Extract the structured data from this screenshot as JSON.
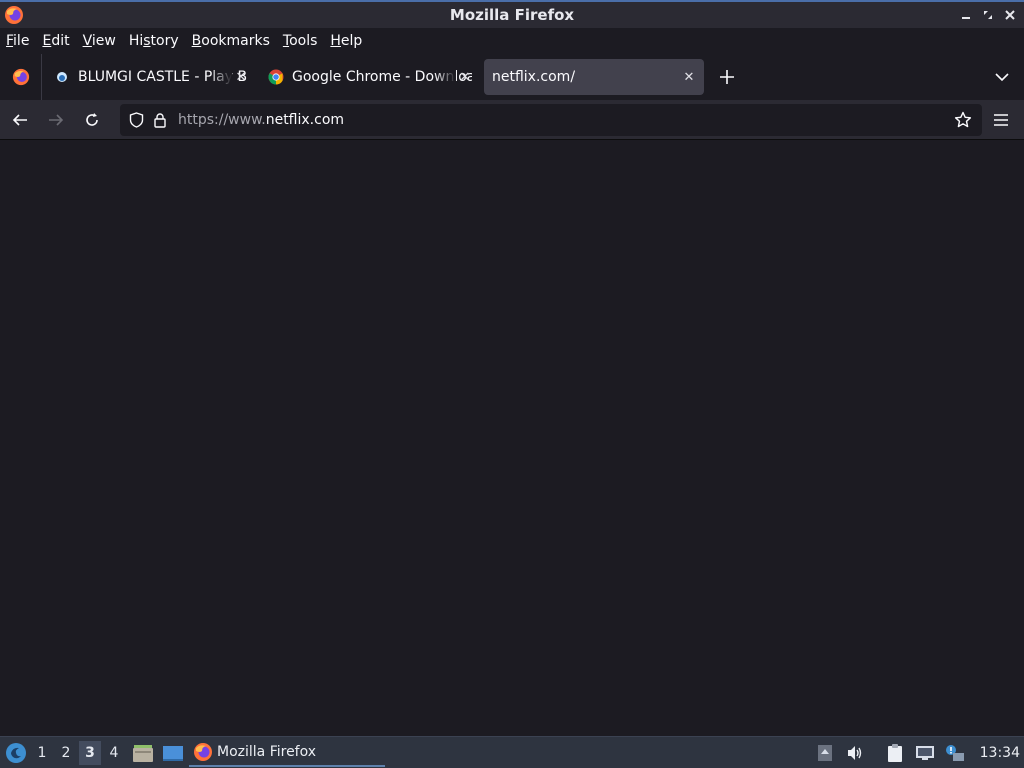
{
  "window": {
    "title": "Mozilla Firefox"
  },
  "menubar": {
    "items": [
      {
        "u": "F",
        "rest": "ile"
      },
      {
        "u": "E",
        "rest": "dit"
      },
      {
        "u": "V",
        "rest": "iew"
      },
      {
        "pre": "Hi",
        "u": "s",
        "rest": "tory"
      },
      {
        "u": "B",
        "rest": "ookmarks"
      },
      {
        "u": "T",
        "rest": "ools"
      },
      {
        "u": "H",
        "rest": "elp"
      }
    ]
  },
  "tabs": [
    {
      "label": "BLUMGI CASTLE - Play Blumgi Castle Online",
      "icon": "blumgi-favicon",
      "active": false
    },
    {
      "label": "Google Chrome - Download the Fast, Secure Browser",
      "icon": "chrome-favicon",
      "active": false
    },
    {
      "label": "netflix.com/",
      "icon": "",
      "active": true
    }
  ],
  "urlbar": {
    "prefix": "https://www.",
    "domain": "netflix.com"
  },
  "taskbar": {
    "workspaces": [
      "1",
      "2",
      "3",
      "4"
    ],
    "current_workspace": "3",
    "task_label": "Mozilla Firefox",
    "clock": "13:34"
  },
  "colors": {
    "accent": "#5e81ac",
    "toolbar": "#2b2a33",
    "content": "#1c1b22"
  }
}
